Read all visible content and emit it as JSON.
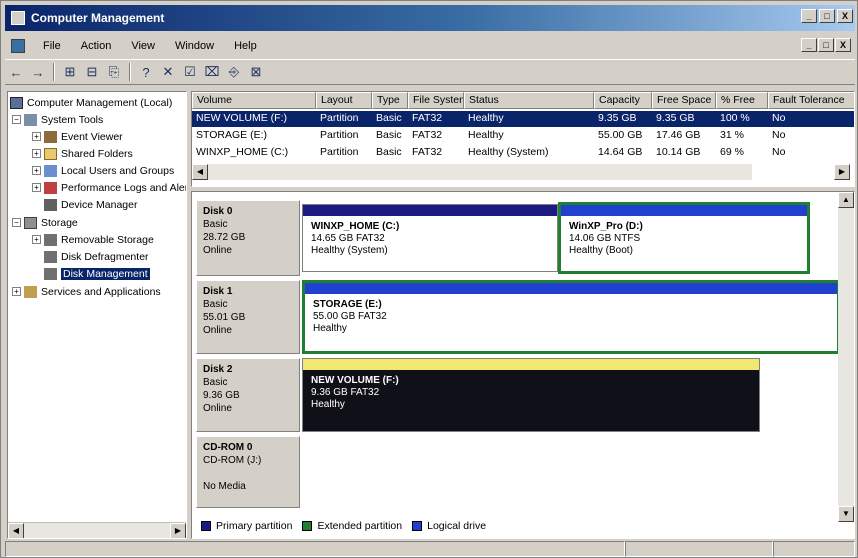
{
  "window": {
    "title": "Computer Management",
    "buttons": [
      "_",
      "□",
      "X"
    ]
  },
  "menubar": {
    "items": [
      "File",
      "Action",
      "View",
      "Window",
      "Help"
    ],
    "mdi_buttons": [
      "_",
      "□",
      "X"
    ]
  },
  "toolbar": {
    "glyphs": [
      "←",
      "→",
      "⊞",
      "⊟",
      "⎘",
      "?",
      "✕",
      "☑",
      "⌧",
      "⎆",
      "⊠"
    ]
  },
  "tree": {
    "items": [
      {
        "label": "Computer Management (Local)",
        "icon": "computer-icon",
        "expander": ""
      },
      {
        "label": "System Tools",
        "icon": "tools-icon",
        "expander": "−"
      },
      {
        "label": "Event Viewer",
        "icon": "event-viewer-icon",
        "expander": "+"
      },
      {
        "label": "Shared Folders",
        "icon": "folder-icon",
        "expander": "+"
      },
      {
        "label": "Local Users and Groups",
        "icon": "users-icon",
        "expander": "+"
      },
      {
        "label": "Performance Logs and Alerts",
        "icon": "performance-icon",
        "expander": "+"
      },
      {
        "label": "Device Manager",
        "icon": "device-manager-icon",
        "expander": ""
      },
      {
        "label": "Storage",
        "icon": "storage-icon",
        "expander": "−"
      },
      {
        "label": "Removable Storage",
        "icon": "removable-storage-icon",
        "expander": "+"
      },
      {
        "label": "Disk Defragmenter",
        "icon": "defragmenter-icon",
        "expander": ""
      },
      {
        "label": "Disk Management",
        "icon": "disk-management-icon",
        "expander": ""
      },
      {
        "label": "Services and Applications",
        "icon": "services-icon",
        "expander": "+"
      }
    ]
  },
  "volumes": {
    "headers": [
      "Volume",
      "Layout",
      "Type",
      "File System",
      "Status",
      "Capacity",
      "Free Space",
      "% Free",
      "Fault Tolerance"
    ],
    "rows": [
      [
        "NEW VOLUME (F:)",
        "Partition",
        "Basic",
        "FAT32",
        "Healthy",
        "9.35 GB",
        "9.35 GB",
        "100 %",
        "No"
      ],
      [
        "STORAGE (E:)",
        "Partition",
        "Basic",
        "FAT32",
        "Healthy",
        "55.00 GB",
        "17.46 GB",
        "31 %",
        "No"
      ],
      [
        "WINXP_HOME (C:)",
        "Partition",
        "Basic",
        "FAT32",
        "Healthy (System)",
        "14.64 GB",
        "10.14 GB",
        "69 %",
        "No"
      ]
    ]
  },
  "disks": [
    {
      "name": "Disk 0",
      "type": "Basic",
      "size": "28.72 GB",
      "state": "Online",
      "partitions": [
        {
          "name": "WINXP_HOME (C:)",
          "size_fs": "14.65 GB FAT32",
          "status": "Healthy (System)"
        },
        {
          "name": "WinXP_Pro (D:)",
          "size_fs": "14.06 GB NTFS",
          "status": "Healthy (Boot)"
        }
      ]
    },
    {
      "name": "Disk 1",
      "type": "Basic",
      "size": "55.01 GB",
      "state": "Online",
      "partitions": [
        {
          "name": "STORAGE (E:)",
          "size_fs": "55.00 GB FAT32",
          "status": "Healthy"
        }
      ]
    },
    {
      "name": "Disk 2",
      "type": "Basic",
      "size": "9.36 GB",
      "state": "Online",
      "partitions": [
        {
          "name": "NEW VOLUME (F:)",
          "size_fs": "9.36 GB FAT32",
          "status": "Healthy"
        }
      ]
    },
    {
      "name": "CD-ROM 0",
      "type": "CD-ROM (J:)",
      "size": "",
      "state": "No Media",
      "partitions": []
    }
  ],
  "legend": [
    {
      "label": "Primary partition",
      "color": "#1a1a80"
    },
    {
      "label": "Extended partition",
      "color": "#208030"
    },
    {
      "label": "Logical drive",
      "color": "#2040d0"
    }
  ]
}
